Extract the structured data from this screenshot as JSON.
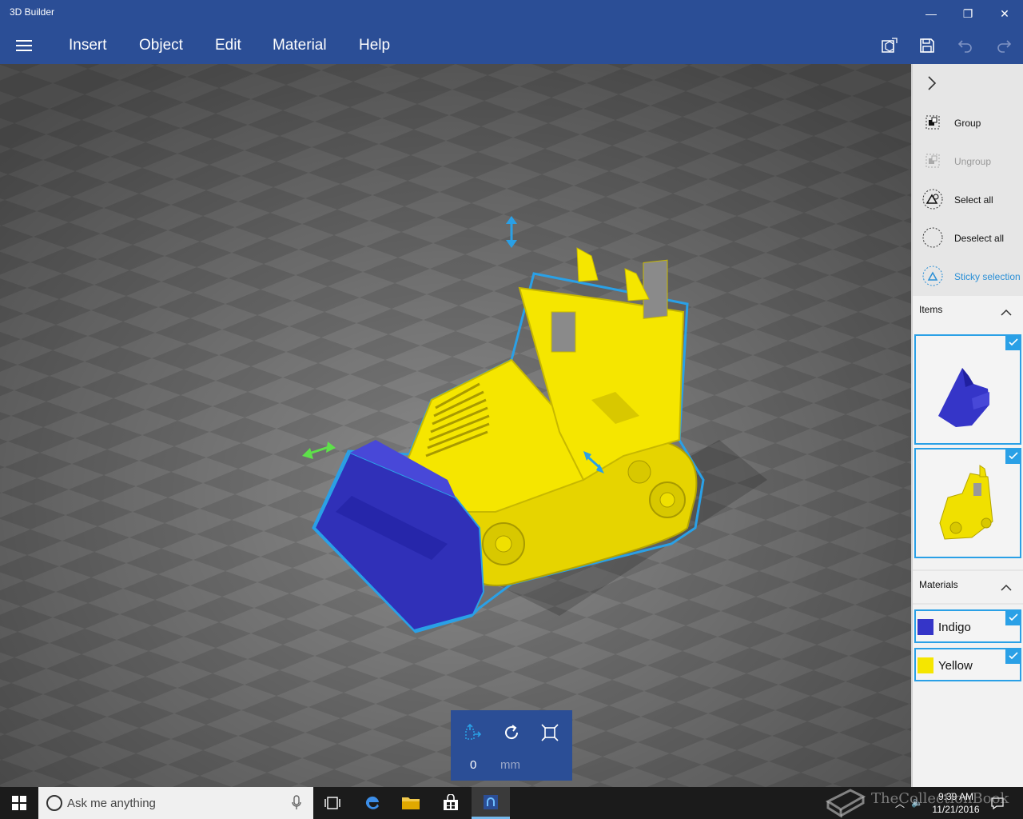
{
  "app": {
    "title": "3D Builder"
  },
  "window_controls": {
    "minimize": "—",
    "restore": "❐",
    "close": "✕"
  },
  "menu": {
    "items": [
      "Insert",
      "Object",
      "Edit",
      "Material",
      "Help"
    ]
  },
  "toolbar_icons": [
    "3d-view-icon",
    "save-icon",
    "undo-icon",
    "redo-icon"
  ],
  "transform": {
    "value": "0",
    "unit": "mm"
  },
  "panel": {
    "actions": [
      {
        "label": "Group",
        "state": "enabled"
      },
      {
        "label": "Ungroup",
        "state": "disabled"
      },
      {
        "label": "Select all",
        "state": "enabled"
      },
      {
        "label": "Deselect all",
        "state": "enabled"
      },
      {
        "label": "Sticky selection",
        "state": "active"
      }
    ],
    "items_header": "Items",
    "items": [
      {
        "name": "scoop",
        "checked": true
      },
      {
        "name": "bulldozer-body",
        "checked": true
      }
    ],
    "materials_header": "Materials",
    "materials": [
      {
        "label": "Indigo",
        "color": "#3535c8",
        "checked": true
      },
      {
        "label": "Yellow",
        "color": "#f5e600",
        "checked": true
      }
    ]
  },
  "taskbar": {
    "search_placeholder": "Ask me anything",
    "time": "9:39 AM",
    "date": "11/21/2016"
  },
  "watermark": "TheCollectionBook",
  "colors": {
    "accent": "#2b4e96",
    "selection": "#2aa0e6",
    "yellow": "#f5e600",
    "indigo": "#3535c8"
  }
}
